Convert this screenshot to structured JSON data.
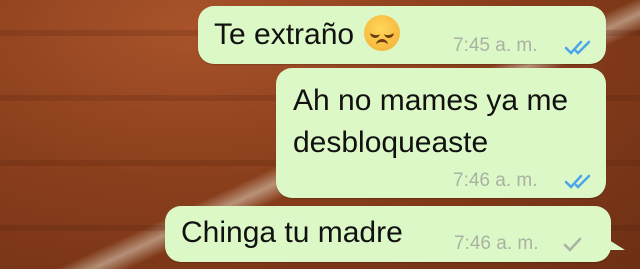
{
  "messages": [
    {
      "text": "Te extraño",
      "emoji": "disappointed-face-emoji",
      "time": "7:45 a. m.",
      "status": "read",
      "status_color": "#4aa5ea"
    },
    {
      "text_lines": [
        "Ah no mames ya me",
        "desbloqueaste"
      ],
      "time": "7:46 a. m.",
      "status": "read",
      "status_color": "#4aa5ea"
    },
    {
      "text": "Chinga tu madre",
      "time": "7:46 a. m.",
      "status": "delivered",
      "status_color": "#a9b2a3"
    }
  ],
  "colors": {
    "bubble": "#dcf8c6",
    "meta": "#a9b2a3",
    "read_ticks": "#4aa5ea"
  }
}
